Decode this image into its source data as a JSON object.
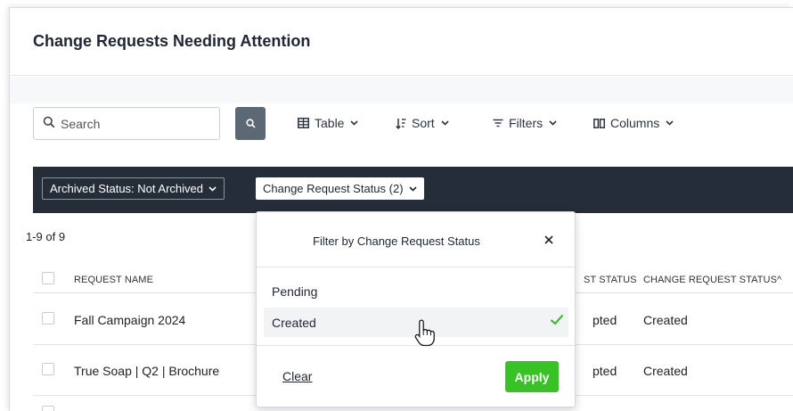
{
  "header": {
    "title": "Change Requests Needing Attention"
  },
  "toolbar": {
    "search_placeholder": "Search",
    "table_label": "Table",
    "sort_label": "Sort",
    "filters_label": "Filters",
    "columns_label": "Columns"
  },
  "filter_bar": {
    "archived_chip": "Archived Status: Not Archived",
    "status_chip": "Change Request Status (2)"
  },
  "list": {
    "count": "1-9 of 9",
    "columns": [
      "REQUEST NAME",
      "ST STATUS",
      "CHANGE REQUEST STATUS^"
    ],
    "rows": [
      {
        "name": "Fall Campaign 2024",
        "partial_status": "pted",
        "change_status": "Created"
      },
      {
        "name": "True Soap | Q2 | Brochure",
        "partial_status": "pted",
        "change_status": "Created"
      }
    ]
  },
  "popover": {
    "title": "Filter by Change Request Status",
    "options": [
      {
        "label": "Pending",
        "selected": false
      },
      {
        "label": "Created",
        "selected": true
      }
    ],
    "clear_label": "Clear",
    "apply_label": "Apply"
  },
  "colors": {
    "filter_bar_bg": "#252d38",
    "apply_green": "#39c226",
    "check_green": "#39c226"
  },
  "icons": [
    "search-icon",
    "table-icon",
    "sort-icon",
    "filter-icon",
    "columns-icon",
    "chevron-down-icon",
    "close-icon",
    "check-icon",
    "hand-cursor-icon"
  ]
}
